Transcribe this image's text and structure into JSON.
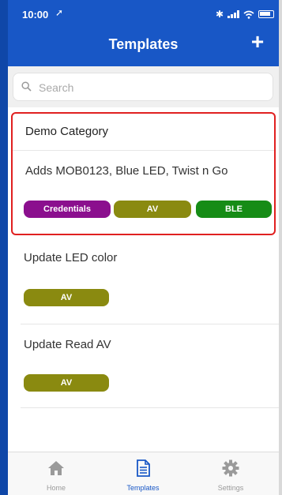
{
  "status_bar": {
    "time": "10:00"
  },
  "nav": {
    "title": "Templates",
    "add_label": "+"
  },
  "search": {
    "placeholder": "Search"
  },
  "category": {
    "title": "Demo Category",
    "template_title": "Adds MOB0123, Blue LED, Twist n Go",
    "tags": [
      {
        "label": "Credentials",
        "color": "#8b0f8e"
      },
      {
        "label": "AV",
        "color": "#8a8a10"
      },
      {
        "label": "BLE",
        "color": "#168c16"
      }
    ]
  },
  "templates": [
    {
      "title": "Update LED color",
      "tags": [
        {
          "label": "AV",
          "color": "#8a8a10"
        }
      ]
    },
    {
      "title": "Update Read AV",
      "tags": [
        {
          "label": "AV",
          "color": "#8a8a10"
        }
      ]
    }
  ],
  "tabbar": {
    "items": [
      {
        "label": "Home",
        "icon": "home-icon"
      },
      {
        "label": "Templates",
        "icon": "document-icon"
      },
      {
        "label": "Settings",
        "icon": "gear-icon"
      }
    ],
    "active": "Templates",
    "accent": "#1857c6"
  }
}
